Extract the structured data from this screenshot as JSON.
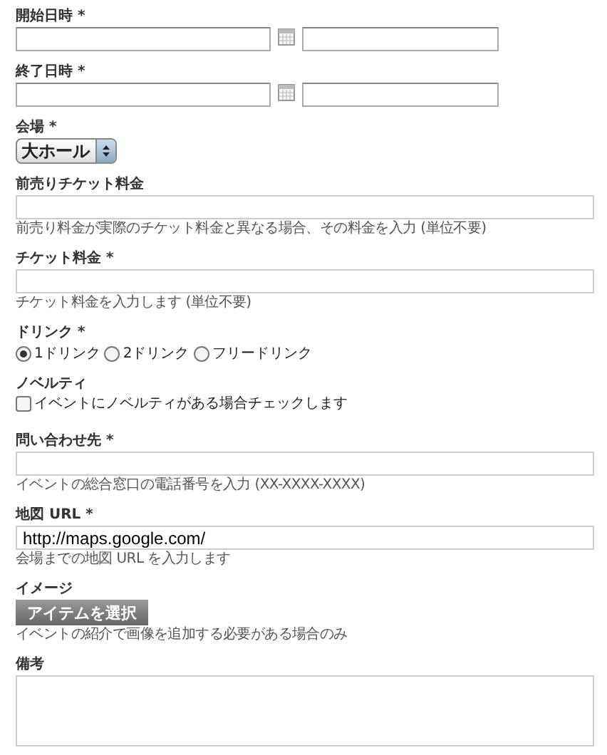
{
  "fields": [
    {
      "kind": "datetime",
      "label": "開始日時 *"
    },
    {
      "kind": "datetime",
      "label": "終了日時 *"
    },
    {
      "kind": "select",
      "label": "会場 *",
      "value": "大ホール"
    },
    {
      "kind": "text",
      "label": "前売りチケット料金",
      "hint": "前売り料金が実際のチケット料金と異なる場合、その料金を入力 (単位不要)"
    },
    {
      "kind": "text",
      "label": "チケット料金 *",
      "hint": "チケット料金を入力します (単位不要)"
    },
    {
      "kind": "radio",
      "label": "ドリンク *",
      "options": [
        {
          "label": "1ドリンク",
          "selected": true
        },
        {
          "label": "2ドリンク",
          "selected": false
        },
        {
          "label": "フリードリンク",
          "selected": false
        }
      ]
    },
    {
      "kind": "checkbox",
      "label": "ノベルティ",
      "text": "イベントにノベルティがある場合チェックします",
      "checked": false
    },
    {
      "kind": "text",
      "label": "問い合わせ先 *",
      "hint": "イベントの総合窓口の電話番号を入力 (XX-XXXX-XXXX)"
    },
    {
      "kind": "text",
      "label": "地図 URL *",
      "value": "http://maps.google.com/",
      "hint": "会場までの地図 URL を入力します"
    },
    {
      "kind": "file",
      "label": "イメージ",
      "button": "アイテムを選択",
      "hint": "イベントの紹介で画像を追加する必要がある場合のみ"
    },
    {
      "kind": "textarea",
      "label": "備考"
    }
  ]
}
